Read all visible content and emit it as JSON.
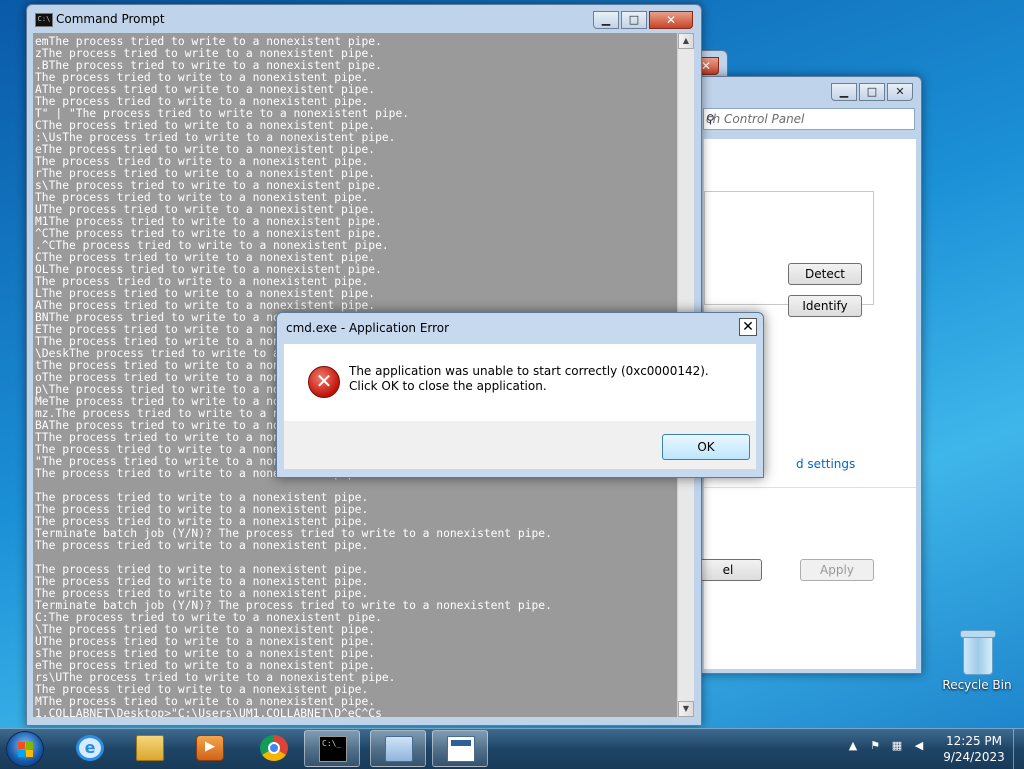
{
  "desktop": {
    "recycle_bin_label": "Recycle Bin"
  },
  "control_panel": {
    "search_placeholder": "ch Control Panel",
    "detect_label": "Detect",
    "identify_label": "Identify",
    "link_text": "d settings",
    "cancel_label": "el",
    "apply_label": "Apply"
  },
  "cmd_window": {
    "title": "Command Prompt",
    "icon_text": "C:\\",
    "console_text": "emThe process tried to write to a nonexistent pipe.\nzThe process tried to write to a nonexistent pipe.\n.BThe process tried to write to a nonexistent pipe.\nThe process tried to write to a nonexistent pipe.\nAThe process tried to write to a nonexistent pipe.\nThe process tried to write to a nonexistent pipe.\nT\" | \"The process tried to write to a nonexistent pipe.\nCThe process tried to write to a nonexistent pipe.\n:\\UsThe process tried to write to a nonexistent pipe.\neThe process tried to write to a nonexistent pipe.\nThe process tried to write to a nonexistent pipe.\nrThe process tried to write to a nonexistent pipe.\ns\\The process tried to write to a nonexistent pipe.\nThe process tried to write to a nonexistent pipe.\nUThe process tried to write to a nonexistent pipe.\nM1The process tried to write to a nonexistent pipe.\n^CThe process tried to write to a nonexistent pipe.\n.^CThe process tried to write to a nonexistent pipe.\nCThe process tried to write to a nonexistent pipe.\nOLThe process tried to write to a nonexistent pipe.\nThe process tried to write to a nonexistent pipe.\nLThe process tried to write to a nonexistent pipe.\nAThe process tried to write to a nonexistent pipe.\nBNThe process tried to write to a nonexistent pipe.\nEThe process tried to write to a nonexistent pipe.\nTThe process tried to write to a nonexistent pipe.\n\\DeskThe process tried to write to a nonexistent pipe.\ntThe process tried to write to a nonexistent pipe.\noThe process tried to write to a nonexistent pipe.\np\\The process tried to write to a nonexistent pipe.\nMeThe process tried to write to a nonexistent pipe.\nmz.The process tried to write to a nonexistent pipe.\nBAThe process tried to write to a nonexistent pipe.\nTThe process tried to write to a nonexistent pipe.\nThe process tried to write to a nonexistent pipe.\n\"The process tried to write to a nonexistent pipe.\nThe process tried to write to a nonexistent pipe.\n\nThe process tried to write to a nonexistent pipe.\nThe process tried to write to a nonexistent pipe.\nThe process tried to write to a nonexistent pipe.\nTerminate batch job (Y/N)? The process tried to write to a nonexistent pipe.\nThe process tried to write to a nonexistent pipe.\n\nThe process tried to write to a nonexistent pipe.\nThe process tried to write to a nonexistent pipe.\nThe process tried to write to a nonexistent pipe.\nTerminate batch job (Y/N)? The process tried to write to a nonexistent pipe.\nC:The process tried to write to a nonexistent pipe.\n\\The process tried to write to a nonexistent pipe.\nUThe process tried to write to a nonexistent pipe.\nsThe process tried to write to a nonexistent pipe.\neThe process tried to write to a nonexistent pipe.\nrs\\UThe process tried to write to a nonexistent pipe.\nThe process tried to write to a nonexistent pipe.\nMThe process tried to write to a nonexistent pipe.\n1.COLLABNET\\Desktop>\"C:\\Users\\UM1.COLLABNET\\D^eC^Cs"
  },
  "error_dialog": {
    "title": "cmd.exe - Application Error",
    "close_glyph": "✕",
    "icon_glyph": "✕",
    "message": "The application was unable to start correctly (0xc0000142). Click OK to close the application.",
    "ok_label": "OK"
  },
  "window_controls": {
    "minimize_glyph": "▁",
    "maximize_glyph": "□",
    "close_glyph": "✕"
  },
  "taskbar": {
    "clock_time": "12:25 PM",
    "clock_date": "9/24/2023",
    "tray_arrow": "▲",
    "media_glyph": "▶",
    "cmd_icon_text": "C:\\_"
  },
  "colors": {
    "console_bg": "#9a9a9a",
    "error_red": "#c0140a",
    "link_blue": "#0066cc"
  }
}
